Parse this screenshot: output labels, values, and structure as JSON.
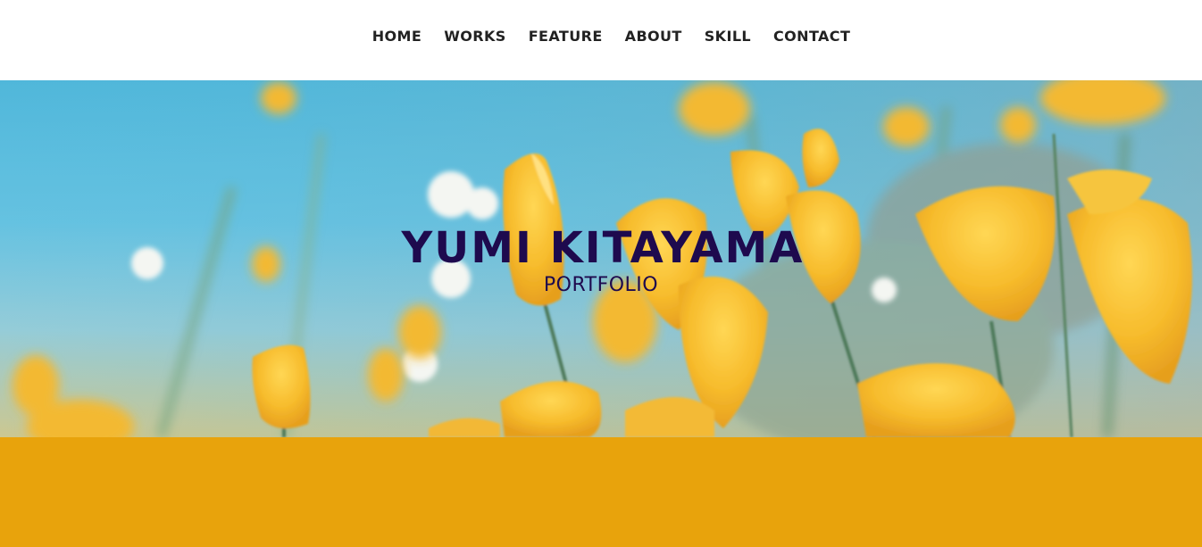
{
  "nav": {
    "items": [
      {
        "label": "HOME"
      },
      {
        "label": "WORKS"
      },
      {
        "label": "FEATURE"
      },
      {
        "label": "ABOUT"
      },
      {
        "label": "SKILL"
      },
      {
        "label": "CONTACT"
      }
    ]
  },
  "hero": {
    "title": "YUMI KITAYAMA",
    "subtitle": "PORTFOLIO",
    "image_subject": "yellow poppy field against blue sky"
  },
  "colors": {
    "title_text": "#1e0a4e",
    "nav_text": "#222222",
    "band": "#e8a30c",
    "sky": "#46b3d8",
    "flower": "#f5b820"
  }
}
